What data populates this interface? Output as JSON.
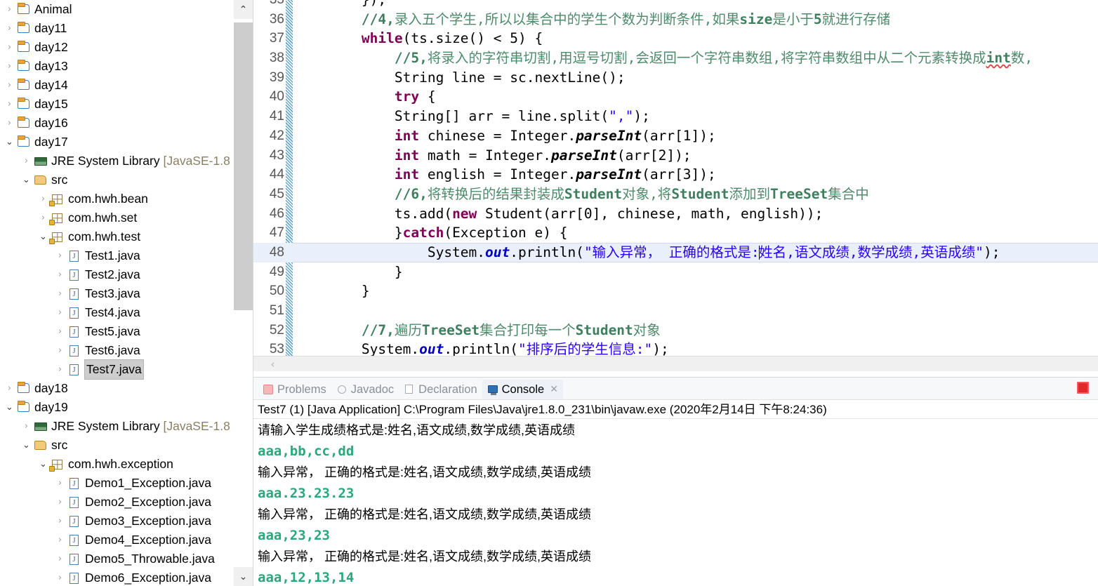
{
  "explorer": {
    "nodes": [
      {
        "indent": 0,
        "twisty": "closed",
        "icon": "project-icon",
        "label": "Animal",
        "dim": ""
      },
      {
        "indent": 0,
        "twisty": "closed",
        "icon": "project-icon",
        "label": "day11",
        "dim": ""
      },
      {
        "indent": 0,
        "twisty": "closed",
        "icon": "project-icon",
        "label": "day12",
        "dim": ""
      },
      {
        "indent": 0,
        "twisty": "closed",
        "icon": "project-icon",
        "label": "day13",
        "dim": ""
      },
      {
        "indent": 0,
        "twisty": "closed",
        "icon": "project-icon",
        "label": "day14",
        "dim": ""
      },
      {
        "indent": 0,
        "twisty": "closed",
        "icon": "project-icon",
        "label": "day15",
        "dim": ""
      },
      {
        "indent": 0,
        "twisty": "closed",
        "icon": "project-icon",
        "label": "day16",
        "dim": ""
      },
      {
        "indent": 0,
        "twisty": "open",
        "icon": "project-icon",
        "label": "day17",
        "dim": ""
      },
      {
        "indent": 1,
        "twisty": "closed",
        "icon": "jre-library-icon",
        "label": "JRE System Library ",
        "dim": "[JavaSE-1.8"
      },
      {
        "indent": 1,
        "twisty": "open",
        "icon": "source-folder-icon",
        "label": "src",
        "dim": ""
      },
      {
        "indent": 2,
        "twisty": "closed",
        "icon": "package-icon",
        "label": "com.hwh.bean",
        "dim": ""
      },
      {
        "indent": 2,
        "twisty": "closed",
        "icon": "package-icon",
        "label": "com.hwh.set",
        "dim": ""
      },
      {
        "indent": 2,
        "twisty": "open",
        "icon": "package-icon",
        "label": "com.hwh.test",
        "dim": ""
      },
      {
        "indent": 3,
        "twisty": "closed",
        "icon": "java-file-icon",
        "label": "Test1.java",
        "dim": ""
      },
      {
        "indent": 3,
        "twisty": "closed",
        "icon": "java-file-icon",
        "label": "Test2.java",
        "dim": ""
      },
      {
        "indent": 3,
        "twisty": "closed",
        "icon": "java-file-icon",
        "label": "Test3.java",
        "dim": ""
      },
      {
        "indent": 3,
        "twisty": "closed",
        "icon": "java-file-icon",
        "label": "Test4.java",
        "dim": ""
      },
      {
        "indent": 3,
        "twisty": "closed",
        "icon": "java-file-icon",
        "label": "Test5.java",
        "dim": ""
      },
      {
        "indent": 3,
        "twisty": "closed",
        "icon": "java-file-icon",
        "label": "Test6.java",
        "dim": ""
      },
      {
        "indent": 3,
        "twisty": "closed",
        "icon": "java-file-icon",
        "label": "Test7.java",
        "dim": "",
        "selected": true
      },
      {
        "indent": 0,
        "twisty": "closed",
        "icon": "project-icon",
        "label": "day18",
        "dim": ""
      },
      {
        "indent": 0,
        "twisty": "open",
        "icon": "project-icon",
        "label": "day19",
        "dim": ""
      },
      {
        "indent": 1,
        "twisty": "closed",
        "icon": "jre-library-icon",
        "label": "JRE System Library ",
        "dim": "[JavaSE-1.8"
      },
      {
        "indent": 1,
        "twisty": "open",
        "icon": "source-folder-icon",
        "label": "src",
        "dim": ""
      },
      {
        "indent": 2,
        "twisty": "open",
        "icon": "package-icon",
        "label": "com.hwh.exception",
        "dim": ""
      },
      {
        "indent": 3,
        "twisty": "closed",
        "icon": "java-file-icon",
        "label": "Demo1_Exception.java",
        "dim": ""
      },
      {
        "indent": 3,
        "twisty": "closed",
        "icon": "java-file-icon",
        "label": "Demo2_Exception.java",
        "dim": ""
      },
      {
        "indent": 3,
        "twisty": "closed",
        "icon": "java-file-icon",
        "label": "Demo3_Exception.java",
        "dim": ""
      },
      {
        "indent": 3,
        "twisty": "closed",
        "icon": "java-file-icon",
        "label": "Demo4_Exception.java",
        "dim": ""
      },
      {
        "indent": 3,
        "twisty": "closed",
        "icon": "java-file-icon",
        "label": "Demo5_Throwable.java",
        "dim": ""
      },
      {
        "indent": 3,
        "twisty": "closed",
        "icon": "java-file-icon",
        "label": "Demo6_Exception.java",
        "dim": ""
      }
    ],
    "scroll": {
      "up_glyph": "⌃",
      "down_glyph": "⌄"
    }
  },
  "editor": {
    "hscroll_left_glyph": "‹",
    "lines": [
      {
        "num": "35",
        "clipped_top": true,
        "segments": [
          {
            "t": "plain",
            "s": "        });"
          }
        ]
      },
      {
        "num": "36",
        "segments": [
          {
            "t": "cmt",
            "s": "        "
          },
          {
            "t": "cmtb",
            "s": "//4,"
          },
          {
            "t": "cmt",
            "s": "录入五个学生,所以以集合中的学生个数为判断条件,如果"
          },
          {
            "t": "cmtb",
            "s": "size"
          },
          {
            "t": "cmt",
            "s": "是小于"
          },
          {
            "t": "cmtb",
            "s": "5"
          },
          {
            "t": "cmt",
            "s": "就进行存储"
          }
        ]
      },
      {
        "num": "37",
        "segments": [
          {
            "t": "plain",
            "s": "        "
          },
          {
            "t": "kw",
            "s": "while"
          },
          {
            "t": "plain",
            "s": "(ts.size() < 5) {"
          }
        ]
      },
      {
        "num": "38",
        "segments": [
          {
            "t": "cmt",
            "s": "            "
          },
          {
            "t": "cmtb",
            "s": "//5,"
          },
          {
            "t": "cmt",
            "s": "将录入的字符串切割,用逗号切割,会返回一个字符串数组,将字符串数组中从二个元素转换成"
          },
          {
            "t": "cmtb sq",
            "s": "int"
          },
          {
            "t": "cmt",
            "s": "数,"
          }
        ]
      },
      {
        "num": "39",
        "segments": [
          {
            "t": "plain",
            "s": "            String line = sc.nextLine();"
          }
        ]
      },
      {
        "num": "40",
        "segments": [
          {
            "t": "plain",
            "s": "            "
          },
          {
            "t": "kw",
            "s": "try"
          },
          {
            "t": "plain",
            "s": " {"
          }
        ]
      },
      {
        "num": "41",
        "segments": [
          {
            "t": "plain",
            "s": "            String[] arr = line.split("
          },
          {
            "t": "str",
            "s": "\",\""
          },
          {
            "t": "plain",
            "s": ");"
          }
        ]
      },
      {
        "num": "42",
        "segments": [
          {
            "t": "plain",
            "s": "            "
          },
          {
            "t": "kw",
            "s": "int"
          },
          {
            "t": "plain",
            "s": " chinese = Integer."
          },
          {
            "t": "stat",
            "s": "parseInt"
          },
          {
            "t": "plain",
            "s": "(arr[1]);"
          }
        ]
      },
      {
        "num": "43",
        "segments": [
          {
            "t": "plain",
            "s": "            "
          },
          {
            "t": "kw",
            "s": "int"
          },
          {
            "t": "plain",
            "s": " math = Integer."
          },
          {
            "t": "stat",
            "s": "parseInt"
          },
          {
            "t": "plain",
            "s": "(arr[2]);"
          }
        ]
      },
      {
        "num": "44",
        "segments": [
          {
            "t": "plain",
            "s": "            "
          },
          {
            "t": "kw",
            "s": "int"
          },
          {
            "t": "plain",
            "s": " english = Integer."
          },
          {
            "t": "stat",
            "s": "parseInt"
          },
          {
            "t": "plain",
            "s": "(arr[3]);"
          }
        ]
      },
      {
        "num": "45",
        "segments": [
          {
            "t": "cmt",
            "s": "            "
          },
          {
            "t": "cmtb",
            "s": "//6,"
          },
          {
            "t": "cmt",
            "s": "将转换后的结果封装成"
          },
          {
            "t": "cmtb",
            "s": "Student"
          },
          {
            "t": "cmt",
            "s": "对象,将"
          },
          {
            "t": "cmtb",
            "s": "Student"
          },
          {
            "t": "cmt",
            "s": "添加到"
          },
          {
            "t": "cmtb",
            "s": "TreeSet"
          },
          {
            "t": "cmt",
            "s": "集合中"
          }
        ]
      },
      {
        "num": "46",
        "segments": [
          {
            "t": "plain",
            "s": "            ts.add("
          },
          {
            "t": "kw",
            "s": "new"
          },
          {
            "t": "plain",
            "s": " Student(arr[0], chinese, math, english));"
          }
        ]
      },
      {
        "num": "47",
        "segments": [
          {
            "t": "plain",
            "s": "            }"
          },
          {
            "t": "kw",
            "s": "catch"
          },
          {
            "t": "plain",
            "s": "(Exception e) {"
          }
        ]
      },
      {
        "num": "48",
        "highlight": true,
        "segments": [
          {
            "t": "plain",
            "s": "                System."
          },
          {
            "t": "field",
            "s": "out"
          },
          {
            "t": "plain",
            "s": ".println("
          },
          {
            "t": "str",
            "s": "\"输入异常， 正确的格式是:"
          },
          {
            "t": "caret",
            "s": ""
          },
          {
            "t": "str",
            "s": "姓名,语文成绩,数学成绩,英语成绩\""
          },
          {
            "t": "plain",
            "s": ");"
          }
        ]
      },
      {
        "num": "49",
        "segments": [
          {
            "t": "plain",
            "s": "            }"
          }
        ]
      },
      {
        "num": "50",
        "segments": [
          {
            "t": "plain",
            "s": "        }"
          }
        ]
      },
      {
        "num": "51",
        "segments": [
          {
            "t": "plain",
            "s": ""
          }
        ]
      },
      {
        "num": "52",
        "segments": [
          {
            "t": "cmt",
            "s": "        "
          },
          {
            "t": "cmtb",
            "s": "//7,"
          },
          {
            "t": "cmt",
            "s": "遍历"
          },
          {
            "t": "cmtb",
            "s": "TreeSet"
          },
          {
            "t": "cmt",
            "s": "集合打印每一个"
          },
          {
            "t": "cmtb",
            "s": "Student"
          },
          {
            "t": "cmt",
            "s": "对象"
          }
        ]
      },
      {
        "num": "53",
        "clipped_bottom": true,
        "segments": [
          {
            "t": "plain",
            "s": "        System."
          },
          {
            "t": "field",
            "s": "out"
          },
          {
            "t": "plain",
            "s": ".println("
          },
          {
            "t": "str",
            "s": "\"排序后的学生信息:\""
          },
          {
            "t": "plain",
            "s": ");"
          }
        ]
      }
    ]
  },
  "panel": {
    "tabs": [
      {
        "label": "Problems",
        "icon": "problems-icon",
        "active": false,
        "closable": false
      },
      {
        "label": "Javadoc",
        "icon": "javadoc-icon",
        "active": false,
        "closable": false
      },
      {
        "label": "Declaration",
        "icon": "declaration-icon",
        "active": false,
        "closable": false
      },
      {
        "label": "Console",
        "icon": "console-icon",
        "active": true,
        "closable": true
      }
    ],
    "close_glyph": "✕",
    "stop_button_label": "Terminate",
    "console_header": "Test7 (1) [Java Application] C:\\Program Files\\Java\\jre1.8.0_231\\bin\\javaw.exe (2020年2月14日 下午8:24:36)",
    "console_lines": [
      {
        "kind": "output",
        "text": "请输入学生成绩格式是:姓名,语文成绩,数学成绩,英语成绩"
      },
      {
        "kind": "input",
        "text": "aaa,bb,cc,dd"
      },
      {
        "kind": "output",
        "text": "输入异常， 正确的格式是:姓名,语文成绩,数学成绩,英语成绩"
      },
      {
        "kind": "input",
        "text": "aaa.23.23.23"
      },
      {
        "kind": "output",
        "text": "输入异常， 正确的格式是:姓名,语文成绩,数学成绩,英语成绩"
      },
      {
        "kind": "input",
        "text": "aaa,23,23"
      },
      {
        "kind": "output",
        "text": "输入异常， 正确的格式是:姓名,语文成绩,数学成绩,英语成绩"
      },
      {
        "kind": "input",
        "text": "aaa,12,13,14"
      }
    ]
  },
  "colors": {
    "selection_blue": "#e9effb",
    "tree_selection": "#cdcdcd",
    "console_input_green": "#2aa77b",
    "keyword_purple": "#7f0055",
    "string_blue": "#2a00ff",
    "comment_green": "#3f7f5f",
    "field_blue": "#0000c0",
    "stop_red": "#e02a2a"
  }
}
